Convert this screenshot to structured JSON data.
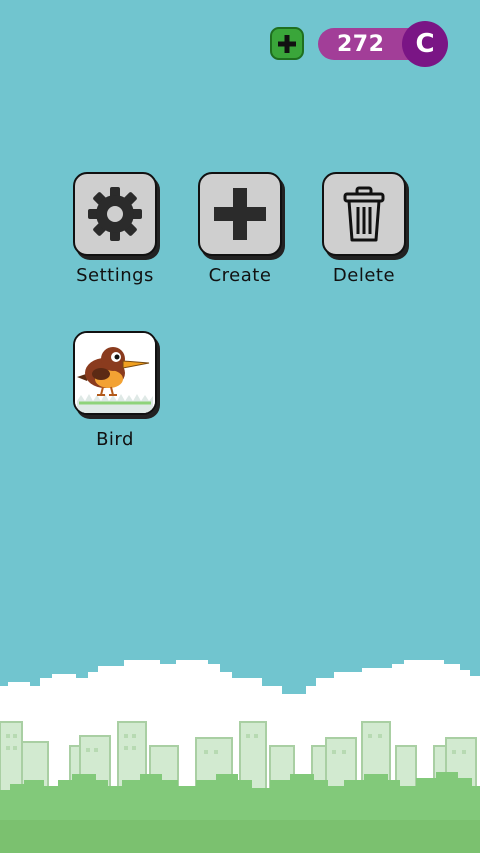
{
  "header": {
    "coins": "272",
    "coin_symbol": "C"
  },
  "menu": {
    "settings_label": "Settings",
    "create_label": "Create",
    "delete_label": "Delete"
  },
  "games": [
    {
      "label": "Bird"
    }
  ],
  "colors": {
    "sky": "#71c5cf",
    "coin_pill": "#a23e98",
    "coin_badge": "#7a1585",
    "add_button": "#3aa63a"
  }
}
